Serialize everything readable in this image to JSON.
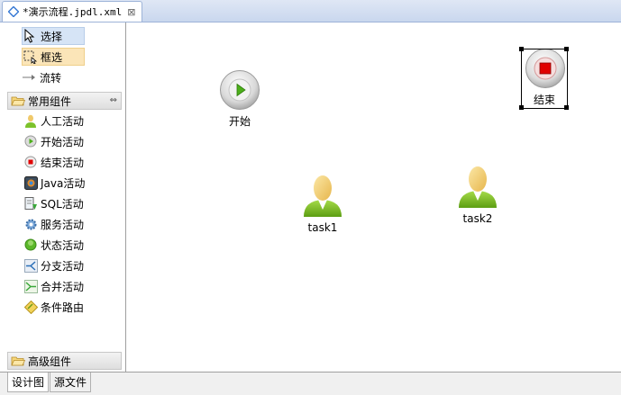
{
  "editor_tab": {
    "title": "*演示流程.jpdl.xml",
    "close_glyph": "⊠",
    "icon": "diamond-icon"
  },
  "palette": {
    "tools": [
      {
        "label": "选择",
        "icon": "arrow-cursor-icon"
      },
      {
        "label": "框选",
        "icon": "marquee-icon"
      },
      {
        "label": "流转",
        "icon": "arrow-right-icon"
      }
    ],
    "common_drawer": {
      "label": "常用组件",
      "pin_glyph": "⇔",
      "items": [
        {
          "label": "人工活动",
          "icon": "user-icon"
        },
        {
          "label": "开始活动",
          "icon": "start-icon"
        },
        {
          "label": "结束活动",
          "icon": "stop-icon"
        },
        {
          "label": "Java活动",
          "icon": "java-icon"
        },
        {
          "label": "SQL活动",
          "icon": "sql-icon"
        },
        {
          "label": "服务活动",
          "icon": "service-gear-icon"
        },
        {
          "label": "状态活动",
          "icon": "state-icon"
        },
        {
          "label": "分支活动",
          "icon": "fork-icon"
        },
        {
          "label": "合并活动",
          "icon": "join-icon"
        },
        {
          "label": "条件路由",
          "icon": "decision-icon"
        }
      ]
    },
    "advanced_drawer": {
      "label": "高级组件"
    }
  },
  "canvas": {
    "nodes": {
      "start": {
        "label": "开始"
      },
      "end": {
        "label": "结束"
      },
      "task1": {
        "label": "task1"
      },
      "task2": {
        "label": "task2"
      }
    },
    "selected_node": "结束"
  },
  "bottom_tabs": [
    {
      "label": "设计图",
      "active": true
    },
    {
      "label": "源文件",
      "active": false
    }
  ],
  "colors": {
    "tab_bg": "#c9d7ee",
    "select_tool_bg": "#d6e4f6",
    "marquee_tool_bg": "#fbe5b8",
    "start_green": "#4caf1a",
    "end_red": "#e00000"
  }
}
